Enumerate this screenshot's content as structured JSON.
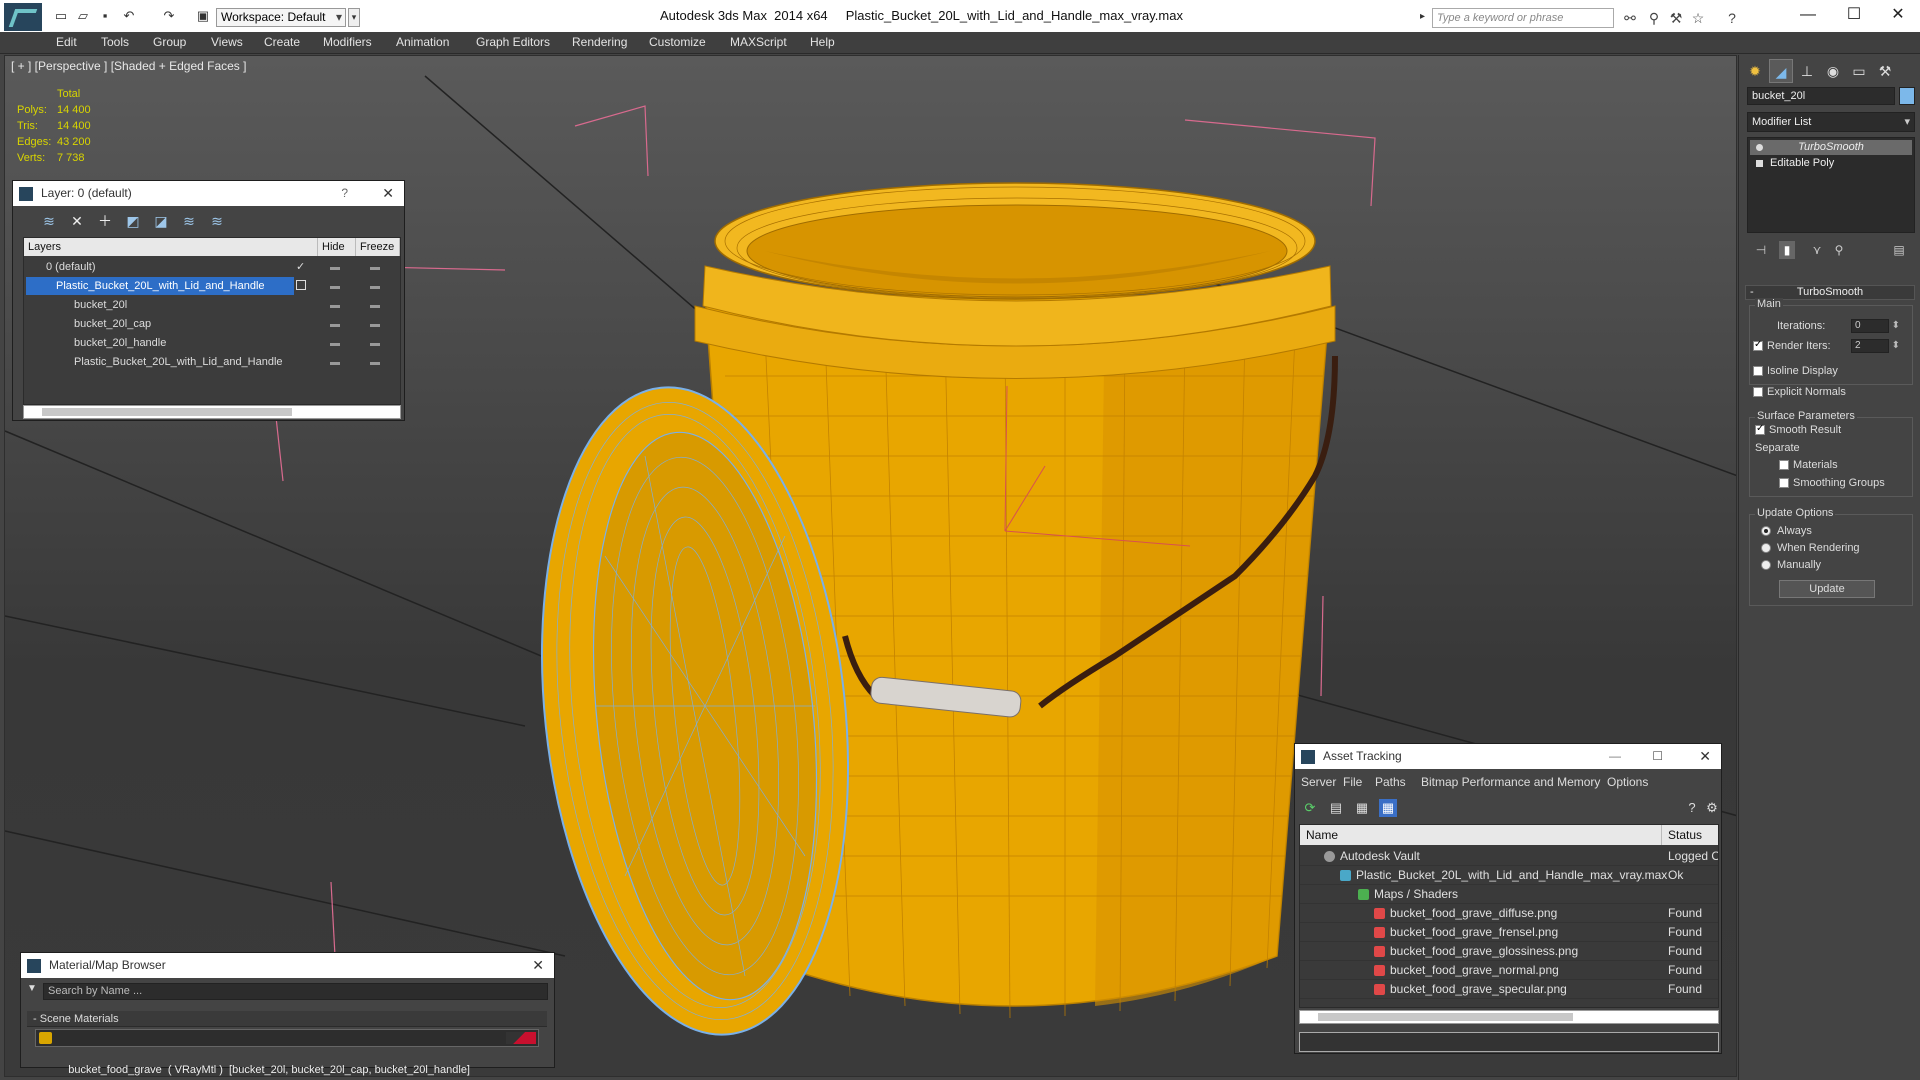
{
  "titlebar": {
    "workspace": "Workspace: Default",
    "app": "Autodesk 3ds Max  2014 x64",
    "file": "Plastic_Bucket_20L_with_Lid_and_Handle_max_vray.max",
    "search_placeholder": "Type a keyword or phrase"
  },
  "menu": [
    "Edit",
    "Tools",
    "Group",
    "Views",
    "Create",
    "Modifiers",
    "Animation",
    "Graph Editors",
    "Rendering",
    "Customize",
    "MAXScript",
    "Help"
  ],
  "viewport": {
    "label": "[ + ] [Perspective ] [Shaded + Edged Faces ]",
    "stats": {
      "header": "Total",
      "rows": [
        {
          "label": "Polys:",
          "value": "14 400"
        },
        {
          "label": "Tris:",
          "value": "14 400"
        },
        {
          "label": "Edges:",
          "value": "43 200"
        },
        {
          "label": "Verts:",
          "value": "7 738"
        }
      ]
    }
  },
  "layer_panel": {
    "title": "Layer: 0 (default)",
    "help": "?",
    "columns": [
      "Layers",
      "Hide",
      "Freeze"
    ],
    "rows": [
      {
        "name": "0 (default)"
      },
      {
        "name": "Plastic_Bucket_20L_with_Lid_and_Handle"
      },
      {
        "name": "bucket_20l"
      },
      {
        "name": "bucket_20l_cap"
      },
      {
        "name": "bucket_20l_handle"
      },
      {
        "name": "Plastic_Bucket_20L_with_Lid_and_Handle"
      }
    ]
  },
  "material_browser": {
    "title": "Material/Map Browser",
    "search_placeholder": "Search by Name ...",
    "section": "Scene Materials",
    "item": "bucket_food_grave  ( VRayMtl )  [bucket_20l, bucket_20l_cap, bucket_20l_handle]",
    "swatch_color": "#c8102e"
  },
  "asset_tracking": {
    "title": "Asset Tracking",
    "menu": [
      "Server",
      "File",
      "Paths",
      "Bitmap Performance and Memory",
      "Options"
    ],
    "columns": [
      "Name",
      "Status"
    ],
    "rows": [
      {
        "name": "Autodesk Vault",
        "status": "Logged O"
      },
      {
        "name": "Plastic_Bucket_20L_with_Lid_and_Handle_max_vray.max",
        "status": "Ok"
      },
      {
        "name": "Maps / Shaders",
        "status": ""
      },
      {
        "name": "bucket_food_grave_diffuse.png",
        "status": "Found"
      },
      {
        "name": "bucket_food_grave_frensel.png",
        "status": "Found"
      },
      {
        "name": "bucket_food_grave_glossiness.png",
        "status": "Found"
      },
      {
        "name": "bucket_food_grave_normal.png",
        "status": "Found"
      },
      {
        "name": "bucket_food_grave_specular.png",
        "status": "Found"
      }
    ]
  },
  "command_panel": {
    "object_name": "bucket_20l",
    "object_color": "#7cb8ea",
    "modifier_list": "Modifier List",
    "stack": [
      "TurboSmooth",
      "Editable Poly"
    ],
    "rollout": "TurboSmooth",
    "main_label": "Main",
    "iterations_label": "Iterations:",
    "iterations_value": "0",
    "render_iters_label": "Render Iters:",
    "render_iters_value": "2",
    "isoline": "Isoline Display",
    "explicit_normals": "Explicit Normals",
    "surface_params": "Surface Parameters",
    "smooth_result": "Smooth Result",
    "separate": "Separate",
    "materials": "Materials",
    "smoothing_groups": "Smoothing Groups",
    "update_options": "Update Options",
    "always": "Always",
    "when_rendering": "When Rendering",
    "manually": "Manually",
    "update_button": "Update"
  },
  "colors": {
    "bucket": "#e8a600",
    "wire": "#c88600",
    "selection": "#2d6ec7"
  }
}
